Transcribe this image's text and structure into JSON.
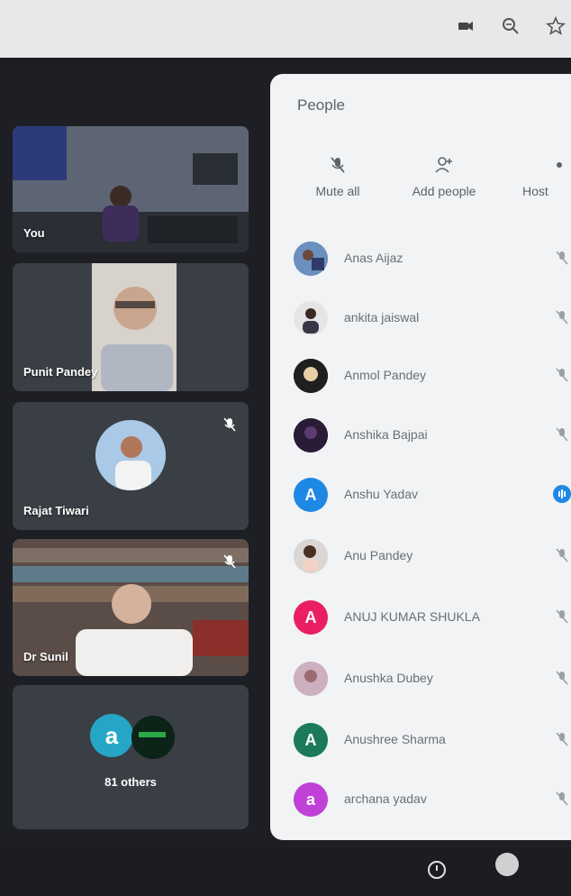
{
  "browser": {
    "icons": [
      "camera-icon",
      "zoom-icon",
      "star-icon"
    ]
  },
  "tiles": [
    {
      "name": "You"
    },
    {
      "name": "Punit Pandey"
    },
    {
      "name": "Rajat Tiwari"
    },
    {
      "name": "Dr Sunil"
    },
    {
      "name": "81 others",
      "avatar_letter": "a"
    }
  ],
  "panel": {
    "title": "People",
    "actions": [
      {
        "label": "Mute all"
      },
      {
        "label": "Add people"
      },
      {
        "label": "Host"
      }
    ],
    "participants": [
      {
        "name": "Anas Aijaz",
        "avatar": "photo"
      },
      {
        "name": "ankita jaiswal",
        "avatar": "photo"
      },
      {
        "name": "Anmol Pandey",
        "avatar": "photo"
      },
      {
        "name": "Anshika Bajpai",
        "avatar": "photo"
      },
      {
        "name": "Anshu Yadav",
        "avatar": "A",
        "color": "#1e88e5"
      },
      {
        "name": "Anu Pandey",
        "avatar": "photo"
      },
      {
        "name": "ANUJ KUMAR SHUKLA",
        "avatar": "A",
        "color": "#e91e63"
      },
      {
        "name": "Anushka Dubey",
        "avatar": "photo"
      },
      {
        "name": "Anushree Sharma",
        "avatar": "A",
        "color": "#1b7a59"
      },
      {
        "name": "archana yadav",
        "avatar": "a",
        "color": "#c040d8"
      }
    ]
  },
  "colors": {
    "accent_blue": "#1e88e5",
    "panel_bg": "#f1f3f4",
    "meeting_bg": "#1d1f24"
  }
}
